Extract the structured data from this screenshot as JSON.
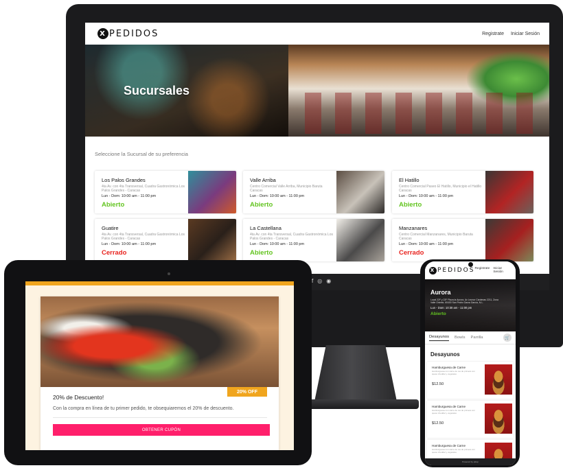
{
  "brand": {
    "logo_mark": "X",
    "logo_text": "PEDIDOS"
  },
  "desktop": {
    "nav": {
      "register": "Registrate",
      "login": "Iniciar Sesión"
    },
    "hero_title": "Sucursales",
    "subtitle": "Seleccione la Sucursal de su preferencia",
    "branches": [
      {
        "name": "Los Palos Grandes",
        "address": "4ta Av. con 4ta Transversal, Cuadra Gastronómica Los Palos Grandes - Caracas",
        "hours": "Lun - Dom: 10:00 am - 11:00 pm",
        "status": "Abierto",
        "status_color": "#63c420",
        "photo_colors": [
          "#2f8f9b",
          "#7a3b7e",
          "#cf5a2a"
        ]
      },
      {
        "name": "Valle Arriba",
        "address": "Centro Comercial Valle Arriba, Municipio Baruta Caracas",
        "hours": "Lun - Dom: 10:00 am - 11:00 pm",
        "status": "Abierto",
        "status_color": "#63c420",
        "photo_colors": [
          "#5b4d42",
          "#c8c2b9",
          "#2d2a28"
        ]
      },
      {
        "name": "El Hatillo",
        "address": "Centro Comercial Paseo El Hatillo, Municipio el Hatillo Caracas",
        "hours": "Lun - Dom: 10:00 am - 11:00 pm",
        "status": "Abierto",
        "status_color": "#63c420",
        "photo_colors": [
          "#3a3634",
          "#b22424",
          "#6b625c"
        ]
      },
      {
        "name": "Guatire",
        "address": "4ta Av. con 4ta Transversal, Cuadra Gastronómica Los Palos Grandes - Caracas",
        "hours": "Lun - Dom: 10:00 am - 11:00 pm",
        "status": "Cerrado",
        "status_color": "#e8231e",
        "photo_colors": [
          "#5a3a22",
          "#2a201a",
          "#9a6c44"
        ]
      },
      {
        "name": "La Castellana",
        "address": "4ta Av. con 4ta Transversal, Cuadra Gastronómica Los Palos Grandes - Caracas",
        "hours": "Lun - Dom: 10:00 am - 11:00 pm",
        "status": "Abierto",
        "status_color": "#63c420",
        "photo_colors": [
          "#f2efe9",
          "#4b4a4a",
          "#a8a29a"
        ]
      },
      {
        "name": "Manzanares",
        "address": "Centro Comercial Manzanares, Municipio Baruta Caracas",
        "hours": "Lun - Dom: 10:00 am - 11:00 pm",
        "status": "Cerrado",
        "status_color": "#e8231e",
        "photo_colors": [
          "#3b3a36",
          "#a62020",
          "#7c8a5a"
        ]
      }
    ],
    "footer_icons": [
      "f",
      "◎",
      "◉"
    ]
  },
  "tablet": {
    "badge": "20% OFF",
    "title": "20% de Descuento!",
    "text": "Con la compra en línea de tu primer pedido, te obsequiaremos el 20% de descuento.",
    "button": "OBTENER CUPÓN",
    "accent": "#f0a51e",
    "button_color": "#ff1f6b"
  },
  "phone": {
    "nav": {
      "register": "Registrate",
      "login": "Iniciar Sesión"
    },
    "hero": {
      "title": "Aurora",
      "address": "Local 22F y 22F Plaza la Aurora, Av Leonor Cárdenas 2211, Zona Valle Oriente, 60400 San Pedro Garza García, N.L.",
      "hours": "Lun - Dom: 10:30 am - 11:00 pm",
      "status": "Abierto"
    },
    "tabs": [
      "Desayunos",
      "Bowls",
      "Parrilla"
    ],
    "cart_icon": "cart-icon",
    "section_title": "Desayunos",
    "items": [
      {
        "name": "Hamburguesa de Carne",
        "desc": "Hamburguesa con carne de res de primera con queso cheddar y vegetales",
        "price": "$12.50"
      },
      {
        "name": "Hamburguesa de Carne",
        "desc": "Hamburguesa con carne de res de primera con queso cheddar y vegetales",
        "price": "$12.50"
      },
      {
        "name": "Hamburguesa de Carne",
        "desc": "Hamburguesa con carne de res de primera con queso cheddar y vegetales",
        "price": ""
      }
    ],
    "footer": "Powered by pikup"
  }
}
